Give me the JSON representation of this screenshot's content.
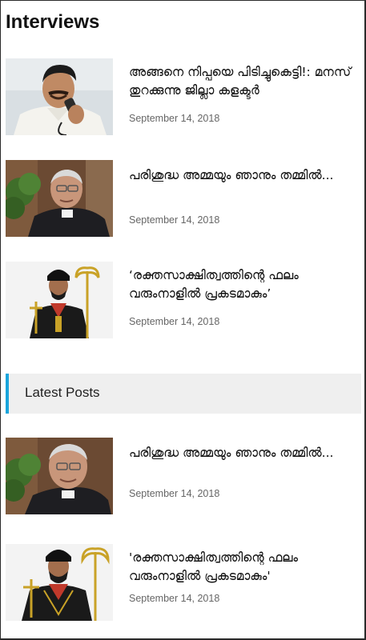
{
  "interviews": {
    "heading": "Interviews",
    "items": [
      {
        "title": "അങ്ങനെ നിപ്പയെ പിടിച്ചുകെട്ടി!: മനസ് തുറക്കുന്നു ജില്ലാ കളക്ടർ",
        "date": "September 14, 2018",
        "thumb_icon": "man-on-phone-photo"
      },
      {
        "title": "പരിശുദ്ധ അമ്മയും ഞാനും തമ്മിൽ...",
        "date": "September 14, 2018",
        "thumb_icon": "bishop-portrait-photo"
      },
      {
        "title": "‘രക്തസാക്ഷിത്വത്തിന്റെ ഫലം വരുംനാളിൽ പ്രകടമാകും’",
        "date": "September 14, 2018",
        "thumb_icon": "priest-with-crosier-photo"
      }
    ]
  },
  "latest": {
    "heading": "Latest Posts",
    "accent_color": "#1aa5dc",
    "items": [
      {
        "title": "പരിശുദ്ധ അമ്മയും ഞാനും തമ്മിൽ...",
        "date": "September 14, 2018",
        "thumb_icon": "bishop-portrait-photo"
      },
      {
        "title": "'രക്തസാക്ഷിത്വത്തിന്റെ ഫലം വരുംനാളിൽ പ്രകടമാകും'",
        "date": "September 14, 2018",
        "thumb_icon": "priest-with-crosier-photo"
      }
    ]
  }
}
